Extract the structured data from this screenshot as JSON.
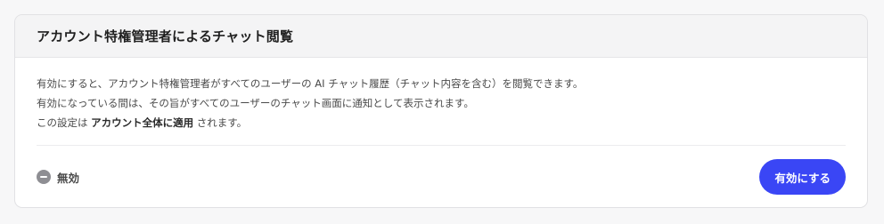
{
  "card": {
    "title": "アカウント特権管理者によるチャット閲覧",
    "description": {
      "line1": "有効にすると、アカウント特権管理者がすべてのユーザーの AI チャット履歴（チャット内容を含む）を閲覧できます。",
      "line2": "有効になっている間は、その旨がすべてのユーザーのチャット画面に通知として表示されます。",
      "line3_prefix": "この設定は ",
      "line3_strong": "アカウント全体に適用",
      "line3_suffix": " されます。"
    },
    "status": {
      "icon": "minus-circle-icon",
      "label": "無効"
    },
    "button_label": "有効にする"
  },
  "colors": {
    "accent": "#3a46f5",
    "status_icon": "#8e8e93",
    "header_bg": "#f4f4f5"
  }
}
